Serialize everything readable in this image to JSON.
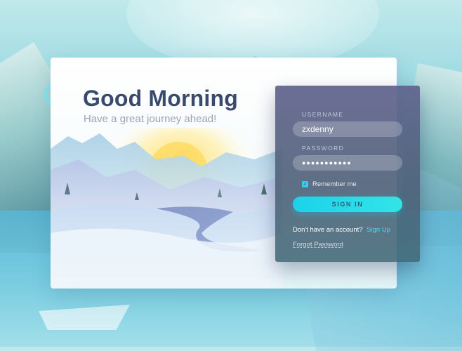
{
  "greeting": {
    "title": "Good Morning",
    "subtitle": "Have a great journey ahead!"
  },
  "login": {
    "username_label": "USERNAME",
    "username_value": "zxdenny",
    "password_label": "PASSWORD",
    "password_value": "●●●●●●●●●●●",
    "remember_label": "Remember me",
    "remember_checked": true,
    "signin_label": "SIGN IN",
    "no_account_text": "Don't have an account?",
    "signup_label": "Sign Up",
    "forgot_label": "Forgot Password"
  },
  "colors": {
    "title": "#3a4a6e",
    "accent": "#2fd1e6",
    "panel": "#5f628c"
  },
  "icons": {
    "checkbox": "check-icon"
  }
}
